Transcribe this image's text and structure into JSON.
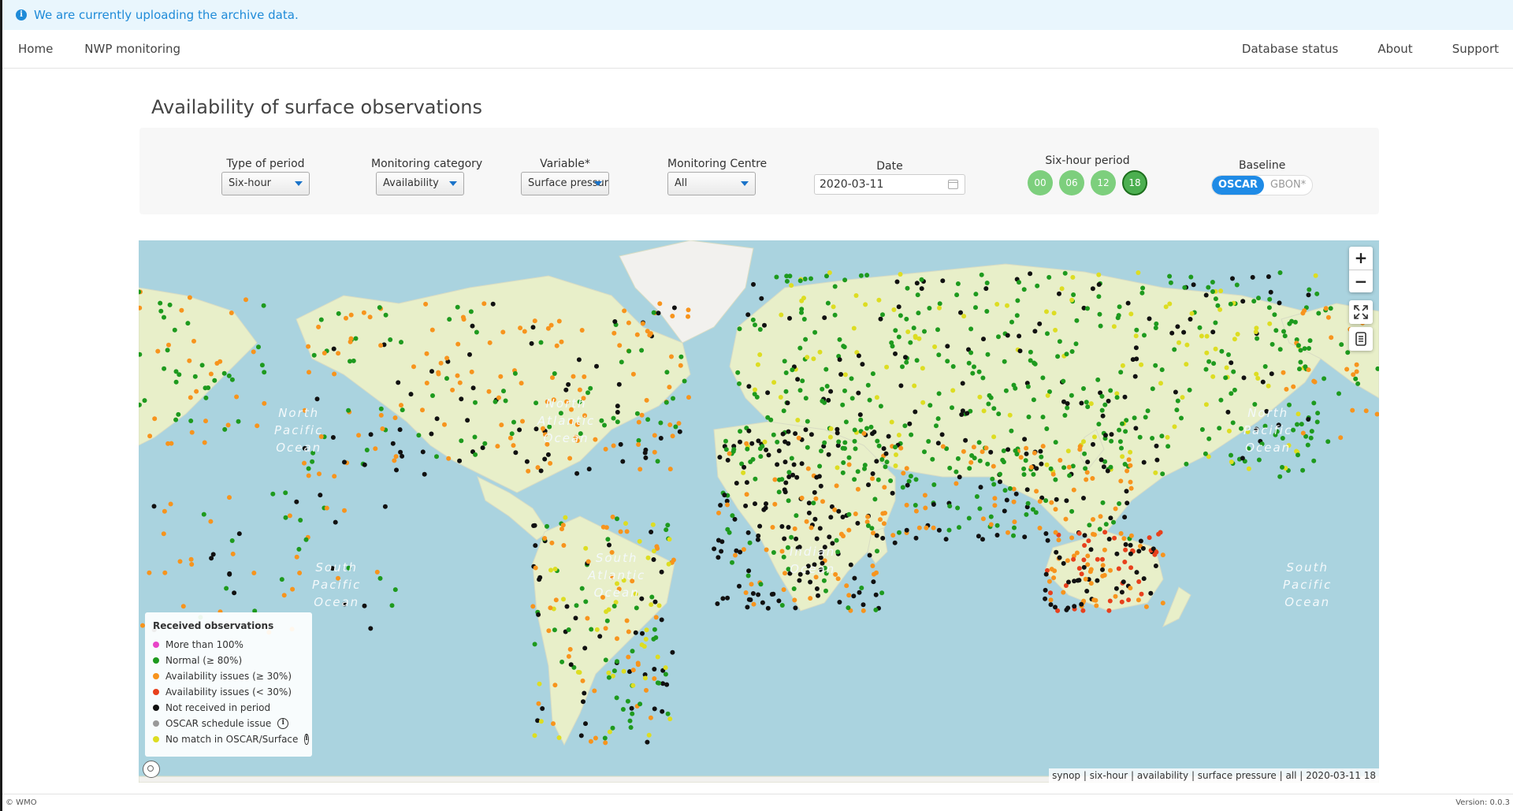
{
  "alert": {
    "message": "We are currently uploading the archive data."
  },
  "nav": {
    "left": [
      "Home",
      "NWP monitoring"
    ],
    "right": [
      "Database status",
      "About",
      "Support"
    ]
  },
  "page": {
    "title": "Availability of surface observations"
  },
  "filters": {
    "type_of_period": {
      "label": "Type of period",
      "value": "Six-hour"
    },
    "monitoring_category": {
      "label": "Monitoring category",
      "value": "Availability"
    },
    "variable": {
      "label": "Variable*",
      "value": "Surface pressure"
    },
    "monitoring_centre": {
      "label": "Monitoring Centre",
      "value": "All"
    },
    "date": {
      "label": "Date",
      "value": "2020-03-11"
    },
    "six_hour_period": {
      "label": "Six-hour period",
      "options": [
        "00",
        "06",
        "12",
        "18"
      ],
      "selected": "18"
    },
    "baseline": {
      "label": "Baseline",
      "options": [
        "OSCAR",
        "GBON*"
      ],
      "selected": "OSCAR"
    }
  },
  "map": {
    "ocean_labels": {
      "north_pacific_left": "North\nPacific\nOcean",
      "north_atlantic": "North\nAtlantic\nOcean",
      "north_pacific_right": "North\nPacific\nOcean",
      "south_pacific_left": "South\nPacific\nOcean",
      "south_atlantic": "South\nAtlantic\nOcean",
      "indian": "Indian\nOcean",
      "south_pacific_right": "South\nPacific\nOcean"
    },
    "zoom_in": "+",
    "zoom_out": "−",
    "attribution": "synop | six-hour | availability | surface pressure | all | 2020-03-11 18",
    "colors": {
      "water": "#aad3df",
      "land": "#e8efc9",
      "ice": "#f2f1ee"
    }
  },
  "legend": {
    "title": "Received observations",
    "items": [
      {
        "label": "More than 100%",
        "color": "#e844c8",
        "info": false
      },
      {
        "label": "Normal (≥ 80%)",
        "color": "#1e9a1e",
        "info": false
      },
      {
        "label": "Availability issues (≥ 30%)",
        "color": "#f7941d",
        "info": false
      },
      {
        "label": "Availability issues (< 30%)",
        "color": "#e8401c",
        "info": false
      },
      {
        "label": "Not received in period",
        "color": "#111111",
        "info": false
      },
      {
        "label": "OSCAR schedule issue",
        "color": "#999999",
        "info": true
      },
      {
        "label": "No match in OSCAR/Surface",
        "color": "#dddd22",
        "info": true
      }
    ]
  },
  "footer": {
    "left": "© WMO",
    "right": "Version: 0.0.3"
  }
}
